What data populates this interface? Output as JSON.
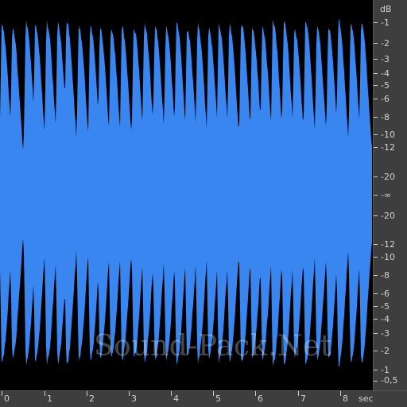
{
  "waveform": {
    "color": "#3a86f0",
    "background": "#000000",
    "duration_sec": 8.7,
    "hit_times_sec": [
      0.0,
      0.25,
      0.57,
      0.79,
      1.06,
      1.32,
      1.53,
      1.82,
      2.09,
      2.32,
      2.58,
      2.84,
      3.12,
      3.37,
      3.62,
      3.88,
      4.13,
      4.38,
      4.63,
      4.89,
      5.13,
      5.38,
      5.66,
      5.92,
      6.16,
      6.41,
      6.67,
      6.92,
      7.18,
      7.45,
      7.72,
      7.96,
      8.25,
      8.5
    ]
  },
  "db_scale": {
    "unit": "dB",
    "labels": [
      "-1",
      "-2",
      "-3",
      "-4",
      "-5",
      "-6",
      "-8",
      "-10",
      "-12",
      "-20",
      "-∞",
      "-20",
      "-12",
      "-10",
      "-8",
      "-6",
      "-5",
      "-4",
      "-3",
      "-2",
      "-1",
      "-0,5"
    ]
  },
  "time_scale": {
    "unit": "sec",
    "labels": [
      "0",
      "1",
      "2",
      "3",
      "4",
      "5",
      "6",
      "7",
      "8"
    ]
  },
  "watermark": "Sound-Pack.Net"
}
